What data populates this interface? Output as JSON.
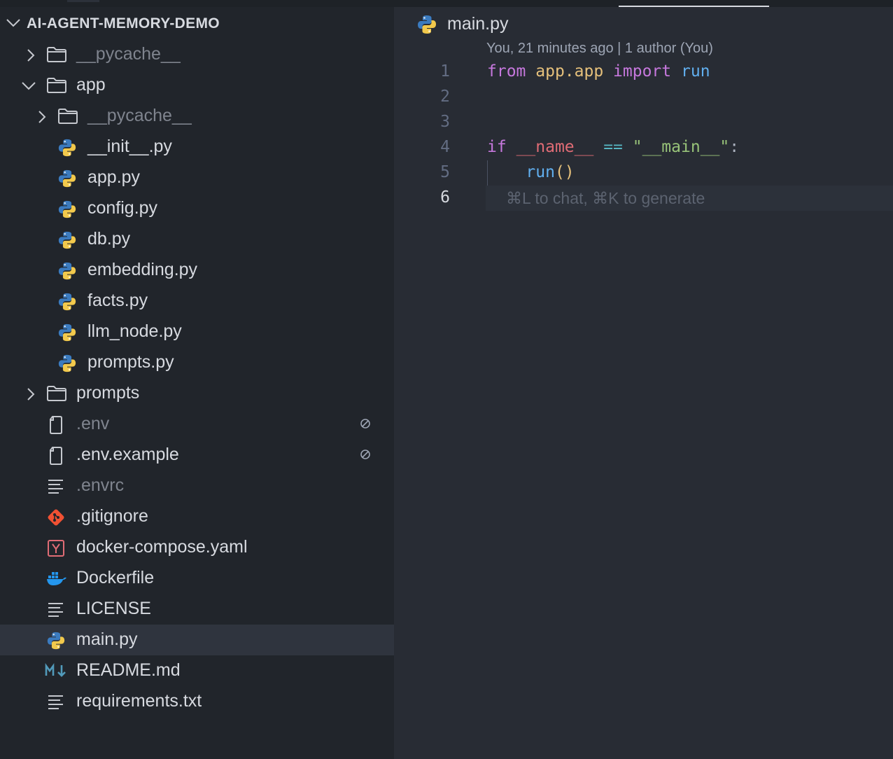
{
  "explorer": {
    "root_title": "AI-AGENT-MEMORY-DEMO",
    "items": [
      {
        "label": "__pycache__",
        "kind": "folder",
        "expanded": false,
        "level": 1,
        "dim": true
      },
      {
        "label": "app",
        "kind": "folder",
        "expanded": true,
        "level": 1,
        "dim": false
      },
      {
        "label": "__pycache__",
        "kind": "folder",
        "expanded": false,
        "level": 2,
        "dim": true
      },
      {
        "label": "__init__.py",
        "kind": "python",
        "level": 2
      },
      {
        "label": "app.py",
        "kind": "python",
        "level": 2
      },
      {
        "label": "config.py",
        "kind": "python",
        "level": 2
      },
      {
        "label": "db.py",
        "kind": "python",
        "level": 2
      },
      {
        "label": "embedding.py",
        "kind": "python",
        "level": 2
      },
      {
        "label": "facts.py",
        "kind": "python",
        "level": 2
      },
      {
        "label": "llm_node.py",
        "kind": "python",
        "level": 2
      },
      {
        "label": "prompts.py",
        "kind": "python",
        "level": 2
      },
      {
        "label": "prompts",
        "kind": "folder",
        "expanded": false,
        "level": 1,
        "dim": false
      },
      {
        "label": ".env",
        "kind": "file",
        "level": 1,
        "dim": true,
        "ignored": true
      },
      {
        "label": ".env.example",
        "kind": "file",
        "level": 1,
        "dim": false,
        "ignored": true
      },
      {
        "label": ".envrc",
        "kind": "text",
        "level": 1,
        "dim": true
      },
      {
        "label": ".gitignore",
        "kind": "git",
        "level": 1
      },
      {
        "label": "docker-compose.yaml",
        "kind": "yaml",
        "level": 1
      },
      {
        "label": "Dockerfile",
        "kind": "docker",
        "level": 1
      },
      {
        "label": "LICENSE",
        "kind": "text",
        "level": 1
      },
      {
        "label": "main.py",
        "kind": "python",
        "level": 1,
        "selected": true
      },
      {
        "label": "README.md",
        "kind": "markdown",
        "level": 1
      },
      {
        "label": "requirements.txt",
        "kind": "text",
        "level": 1
      }
    ]
  },
  "editor": {
    "tab_label": "main.py",
    "blame": "You, 21 minutes ago | 1 author (You)",
    "line_numbers": [
      "1",
      "2",
      "3",
      "4",
      "5",
      "6"
    ],
    "code": {
      "l1_from": "from",
      "l1_module": "app.app",
      "l1_import": "import",
      "l1_name": "run",
      "l4_if": "if",
      "l4_var": "__name__",
      "l4_op": "==",
      "l4_str": "\"__main__\"",
      "l4_colon": ":",
      "l5_fn": "run",
      "l5_parens": "()"
    },
    "inline_hint": "⌘L to chat, ⌘K to generate",
    "active_line": 6
  },
  "colors": {
    "sidebar_bg": "#21252b",
    "editor_bg": "#282c34",
    "selected_row": "#2f343e",
    "keyword": "#c678dd",
    "module": "#e5c07b",
    "function": "#61afef",
    "variable": "#e06c75",
    "string": "#98c379",
    "operator": "#56b6c2"
  }
}
